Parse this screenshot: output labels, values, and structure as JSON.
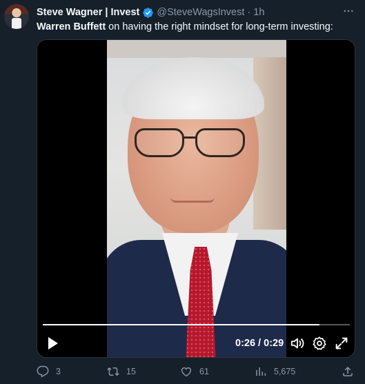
{
  "tweet": {
    "author_name": "Steve Wagner | Invest",
    "handle": "@SteveWagsInvest",
    "separator": "·",
    "time": "1h",
    "text_bold": "Warren Buffett",
    "text_rest": " on having the right mindset for long-term investing:"
  },
  "video": {
    "progress_fraction": 0.9,
    "current_time": "0:26",
    "time_separator": " / ",
    "duration": "0:29"
  },
  "actions": {
    "replies": "3",
    "retweets": "15",
    "likes": "61",
    "views": "5,675"
  },
  "icons": {
    "verified": "verified-badge-icon",
    "more": "more-options-icon",
    "play": "play-icon",
    "volume": "volume-icon",
    "settings": "gear-icon",
    "fullscreen": "fullscreen-icon",
    "reply": "reply-icon",
    "retweet": "retweet-icon",
    "like": "heart-icon",
    "views": "views-icon",
    "share": "share-icon"
  },
  "colors": {
    "background": "#15202b",
    "verified": "#1d9bf0",
    "muted": "#8b98a5"
  }
}
